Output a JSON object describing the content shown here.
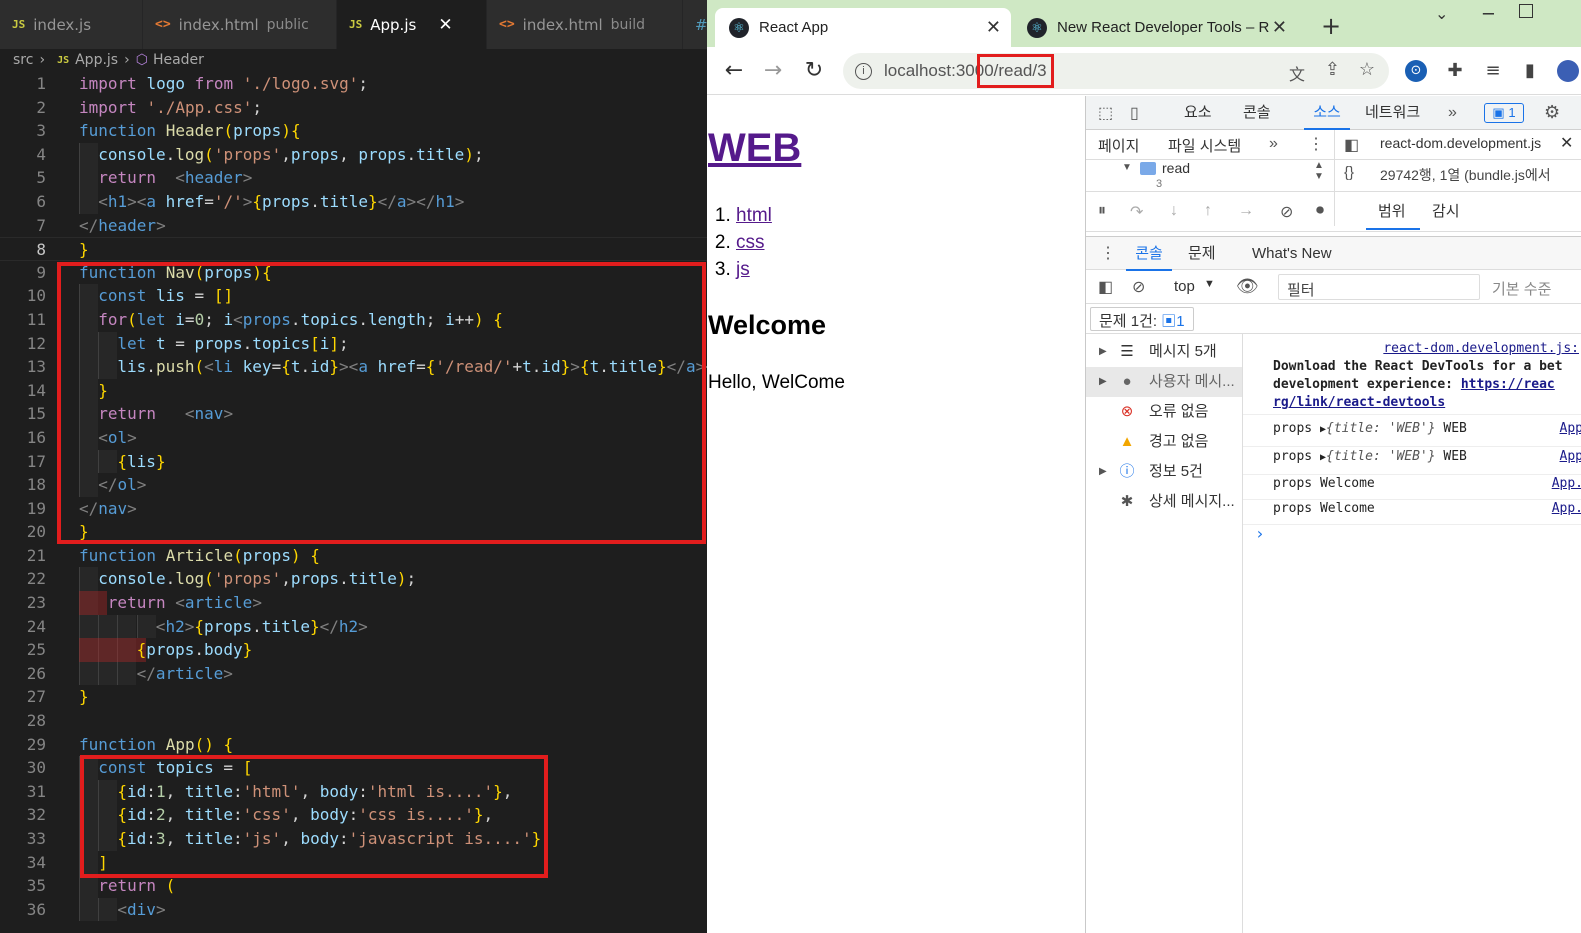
{
  "editor": {
    "tabs": [
      {
        "icon": "JS",
        "name": "index.js",
        "sub": ""
      },
      {
        "icon": "<>",
        "name": "index.html",
        "sub": "public"
      },
      {
        "icon": "JS",
        "name": "App.js",
        "sub": "",
        "close": "✕"
      },
      {
        "icon": "<>",
        "name": "index.html",
        "sub": "build"
      },
      {
        "icon": "#",
        "name": "",
        "sub": ""
      }
    ],
    "breadcrumb": {
      "folder": "src",
      "file": "App.js",
      "symbol": "Header"
    },
    "line_numbers": [
      "1",
      "2",
      "3",
      "4",
      "5",
      "6",
      "7",
      "8",
      "9",
      "10",
      "11",
      "12",
      "13",
      "14",
      "15",
      "16",
      "17",
      "18",
      "19",
      "20",
      "21",
      "22",
      "23",
      "24",
      "25",
      "26",
      "27",
      "28",
      "29",
      "30",
      "31",
      "32",
      "33",
      "34",
      "35",
      "36"
    ],
    "lines": [
      "import logo from './logo.svg';",
      "import './App.css';",
      "function Header(props){",
      "  console.log('props',props, props.title);",
      "  return  <header>",
      "  <h1><a href='/'>{props.title}</a></h1>",
      "</header>",
      "}",
      "function Nav(props){",
      "  const lis = []",
      "  for(let i=0; i<props.topics.length; i++) {",
      "    let t = props.topics[i];",
      "    lis.push(<li key={t.id}><a href={'/read/'+t.id}>{t.title}</a></li>)",
      "  }",
      "  return   <nav>",
      "  <ol>",
      "    {lis}",
      "  </ol>",
      "</nav>",
      "}",
      "function Article(props) {",
      "  console.log('props',props.title);",
      "   return <article>",
      "        <h2>{props.title}</h2>",
      "      {props.body}",
      "      </article>",
      "}",
      "",
      "function App() {",
      "  const topics = [",
      "    {id:1, title:'html', body:'html is....'},",
      "    {id:2, title:'css', body:'css is....'},",
      "    {id:3, title:'js', body:'javascript is....'}",
      "  ]",
      "  return (",
      "    <div>"
    ]
  },
  "browser": {
    "tabs": [
      {
        "title": "React App",
        "close": "✕"
      },
      {
        "title": "New React Developer Tools – R",
        "close": "✕"
      }
    ],
    "new_tab": "+",
    "url": {
      "host": "localhost:300",
      "path": "0/read/3"
    },
    "page": {
      "heading": "WEB",
      "topics": [
        "html",
        "css",
        "js"
      ],
      "article_title": "Welcome",
      "article_body": "Hello, WelCome"
    }
  },
  "devtools": {
    "main_tabs": [
      "요소",
      "콘솔",
      "소스",
      "네트워크"
    ],
    "active_main_tab": "소스",
    "badge_count": "1",
    "nav_tabs": [
      "페이지",
      "파일 시스템"
    ],
    "tree_folder": "read",
    "tree_child": "3",
    "editor_file": "react-dom.development.js",
    "status": "29742행, 1열  (bundle.js에서",
    "scope_tabs": [
      "범위",
      "감시"
    ],
    "drawer_tabs": [
      "콘솔",
      "문제",
      "What's New"
    ],
    "context": "top",
    "filter_placeholder": "필터",
    "levels": "기본 수준",
    "issues": "문제 1건:",
    "issues_count": "1",
    "sidebar": [
      {
        "label": "메시지 5개",
        "icon": "list-icon"
      },
      {
        "label": "사용자 메시...",
        "icon": "user-icon"
      },
      {
        "label": "오류 없음",
        "icon": "error-icon"
      },
      {
        "label": "경고 없음",
        "icon": "warning-icon"
      },
      {
        "label": "정보 5건",
        "icon": "info-icon"
      },
      {
        "label": "상세 메시지...",
        "icon": "bug-icon"
      }
    ],
    "console": {
      "source1": "react-dom.development.js:",
      "msg1": "Download the React DevTools for a bet",
      "msg2": "development experience:",
      "link1": "https://reac",
      "link2": "rg/link/react-devtools",
      "rows": [
        {
          "label": "props",
          "obj": "{title: 'WEB'}",
          "value": "WEB",
          "src": "App"
        },
        {
          "label": "props",
          "obj": "{title: 'WEB'}",
          "value": "WEB",
          "src": "App"
        },
        {
          "label": "props",
          "obj": "",
          "value": "Welcome",
          "src": "App."
        },
        {
          "label": "props",
          "obj": "",
          "value": "Welcome",
          "src": "App."
        }
      ],
      "prompt": "›"
    }
  }
}
